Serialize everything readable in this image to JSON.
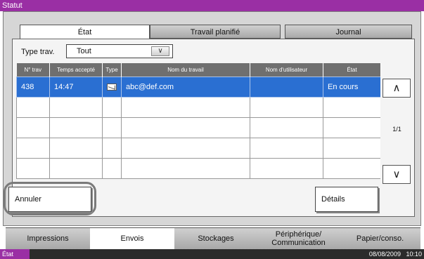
{
  "title": "Statut",
  "tabs": [
    {
      "label": "État",
      "active": true
    },
    {
      "label": "Travail planifié",
      "active": false
    },
    {
      "label": "Journal",
      "active": false
    }
  ],
  "filter": {
    "label": "Type trav.",
    "value": "Tout"
  },
  "table": {
    "columns": [
      "N° trav",
      "Temps accepté",
      "Type",
      "Nom du travail",
      "Nom d'utilisateur",
      "État"
    ],
    "rows": [
      {
        "id": "438",
        "time": "14:47",
        "type_icon": "email-icon",
        "name": "abc@def.com",
        "user": "",
        "status": "En cours",
        "selected": true
      }
    ],
    "empty_rows": 4
  },
  "pager": {
    "page": "1/1"
  },
  "buttons": {
    "cancel": "Annuler",
    "details": "Détails"
  },
  "bottom_tabs": [
    {
      "label": "Impressions",
      "active": false
    },
    {
      "label": "Envois",
      "active": true
    },
    {
      "label": "Stockages",
      "active": false
    },
    {
      "label": "Périphérique/ Communication",
      "active": false
    },
    {
      "label": "Papier/conso.",
      "active": false
    }
  ],
  "statusbar": {
    "label": "État",
    "date": "08/08/2009",
    "time": "10:10"
  },
  "colors": {
    "accent": "#9a2fa4",
    "selected_row": "#2a6fd2",
    "header": "#6f6f6f"
  }
}
